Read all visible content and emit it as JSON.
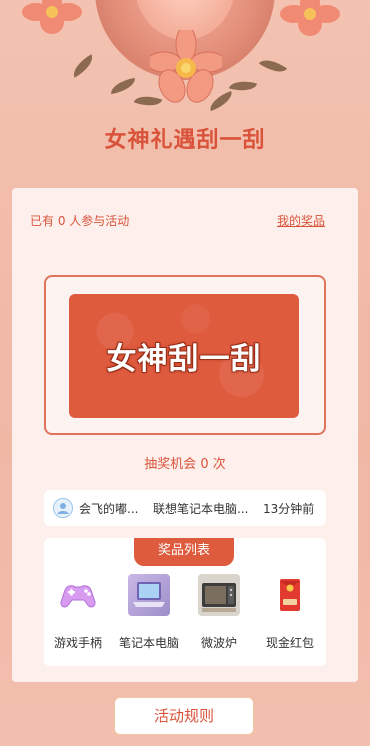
{
  "page": {
    "title": "女神礼遇刮一刮"
  },
  "stats": {
    "participants_text": "已有 0 人参与活动",
    "my_prize_label": "我的奖品"
  },
  "scratch_card": {
    "label": "女神刮一刮"
  },
  "chances_text": "抽奖机会 0 次",
  "ticker": {
    "user": "会飞的嘟...",
    "prize": "联想笔记本电脑...",
    "time": "13分钟前"
  },
  "prize_list": {
    "header": "奖品列表",
    "items": [
      {
        "name": "游戏手柄",
        "icon": "gamepad-image"
      },
      {
        "name": "笔记本电脑",
        "icon": "laptop-image"
      },
      {
        "name": "微波炉",
        "icon": "microwave-image"
      },
      {
        "name": "现金红包",
        "icon": "red-envelope-image"
      }
    ]
  },
  "rules_button": {
    "label": "活动规则"
  },
  "colors": {
    "accent": "#df5b3e",
    "background": "#f0b7a5",
    "card": "#fdf0ec"
  }
}
